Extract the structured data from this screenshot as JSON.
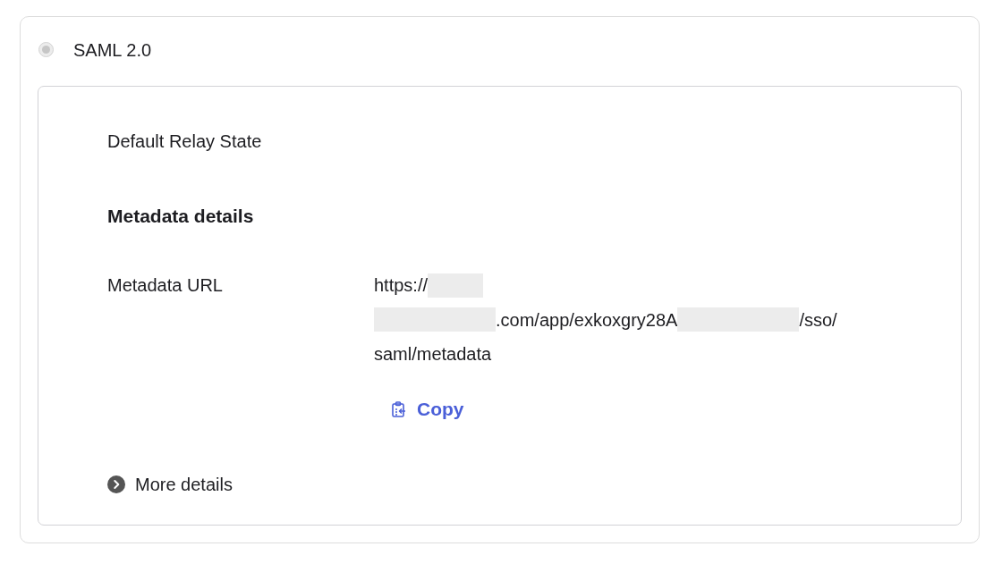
{
  "option": {
    "label": "SAML 2.0",
    "selected": true,
    "disabled": true
  },
  "settings": {
    "default_relay_state": {
      "label": "Default Relay State"
    },
    "metadata_details": {
      "heading": "Metadata details",
      "metadata_url": {
        "label": "Metadata URL",
        "lines": [
          [
            {
              "kind": "text",
              "text": "https://"
            },
            {
              "kind": "redacted"
            }
          ],
          [
            {
              "kind": "redacted"
            },
            {
              "kind": "text",
              "text": ".com/app/exkoxgry28A"
            },
            {
              "kind": "redacted"
            },
            {
              "kind": "text",
              "text": "/sso/"
            }
          ],
          [
            {
              "kind": "text",
              "text": "saml/metadata"
            }
          ]
        ]
      },
      "copy_button": {
        "label": "Copy"
      }
    },
    "more_details": {
      "label": "More details",
      "expanded": false
    }
  }
}
